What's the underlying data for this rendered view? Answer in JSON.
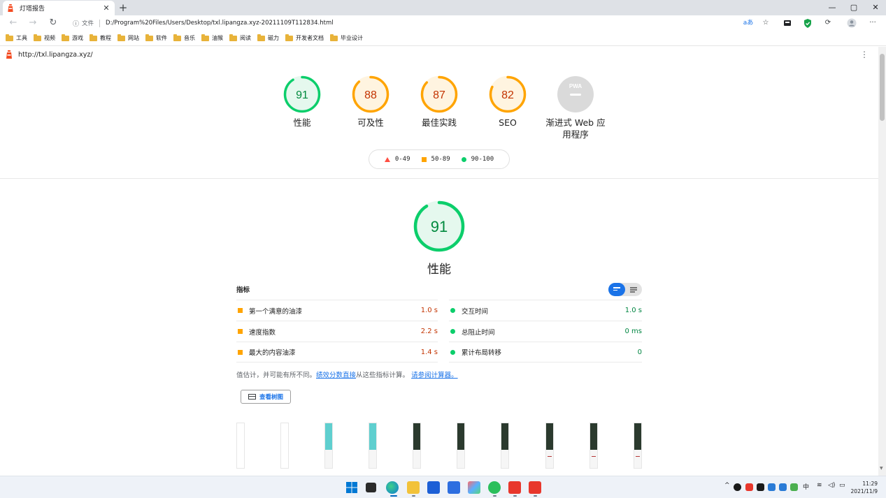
{
  "browser": {
    "tab_title": "灯塔报告",
    "tab_close": "✕",
    "new_tab": "+",
    "window_controls": [
      "—",
      "▢",
      "✕"
    ],
    "nav": {
      "back": "←",
      "forward": "→",
      "reload": "↻"
    },
    "address": {
      "info_icon": "ⓘ",
      "file_label": "文件",
      "url": "D:/Program%20Files/Users/Desktop/txl.lipangza.xyz-20211109T112834.html"
    },
    "toolbar_icons": [
      "read-aloud-icon",
      "favorites-add-icon",
      "collections-icon",
      "shield-extension-icon",
      "extensions-icon",
      "profile-icon",
      "more-icon"
    ],
    "bookmarks": [
      "工具",
      "视频",
      "游戏",
      "教程",
      "网站",
      "软件",
      "音乐",
      "油猴",
      "阅读",
      "磁力",
      "开发者文档",
      "毕业设计"
    ]
  },
  "report": {
    "url": "http://txl.lipangza.xyz/",
    "menu_glyph": "⋮",
    "gauges": [
      {
        "score": "91",
        "label": "性能",
        "color": "#0cce6b",
        "fill": "#e5f8ee",
        "fraction": 0.91
      },
      {
        "score": "88",
        "label": "可及性",
        "color": "#ffa400",
        "fill": "#fff4e0",
        "fraction": 0.88
      },
      {
        "score": "87",
        "label": "最佳实践",
        "color": "#ffa400",
        "fill": "#fff4e0",
        "fraction": 0.87
      },
      {
        "score": "82",
        "label": "SEO",
        "color": "#ffa400",
        "fill": "#fff4e0",
        "fraction": 0.82
      }
    ],
    "pwa": {
      "badge": "PWA",
      "label_line1": "渐进式 Web 应",
      "label_line2": "用程序"
    },
    "legend": {
      "fail": "0-49",
      "average": "50-89",
      "pass": "90-100"
    },
    "performance": {
      "score": "91",
      "fraction": 0.91,
      "title": "性能",
      "metrics_header": "指标",
      "metrics_left": [
        {
          "name": "第一个满意的油漆",
          "value": "1.0 s",
          "status": "average"
        },
        {
          "name": "速度指数",
          "value": "2.2 s",
          "status": "average"
        },
        {
          "name": "最大的内容油漆",
          "value": "1.4 s",
          "status": "average"
        }
      ],
      "metrics_right": [
        {
          "name": "交互时间",
          "value": "1.0 s",
          "status": "pass"
        },
        {
          "name": "总阻止时间",
          "value": "0 ms",
          "status": "pass"
        },
        {
          "name": "累计布局转移",
          "value": "0",
          "status": "pass"
        }
      ],
      "note_prefix": "值估计，并可能有所不同。",
      "note_link1": "绩效分数直接",
      "note_middle": "从这些指标计算。",
      "note_link2": "请参阅计算器。",
      "treemap_button": "查看树图"
    }
  },
  "taskbar": {
    "tray_lang": "中",
    "time": "11:29",
    "date": "2021/11/9"
  }
}
